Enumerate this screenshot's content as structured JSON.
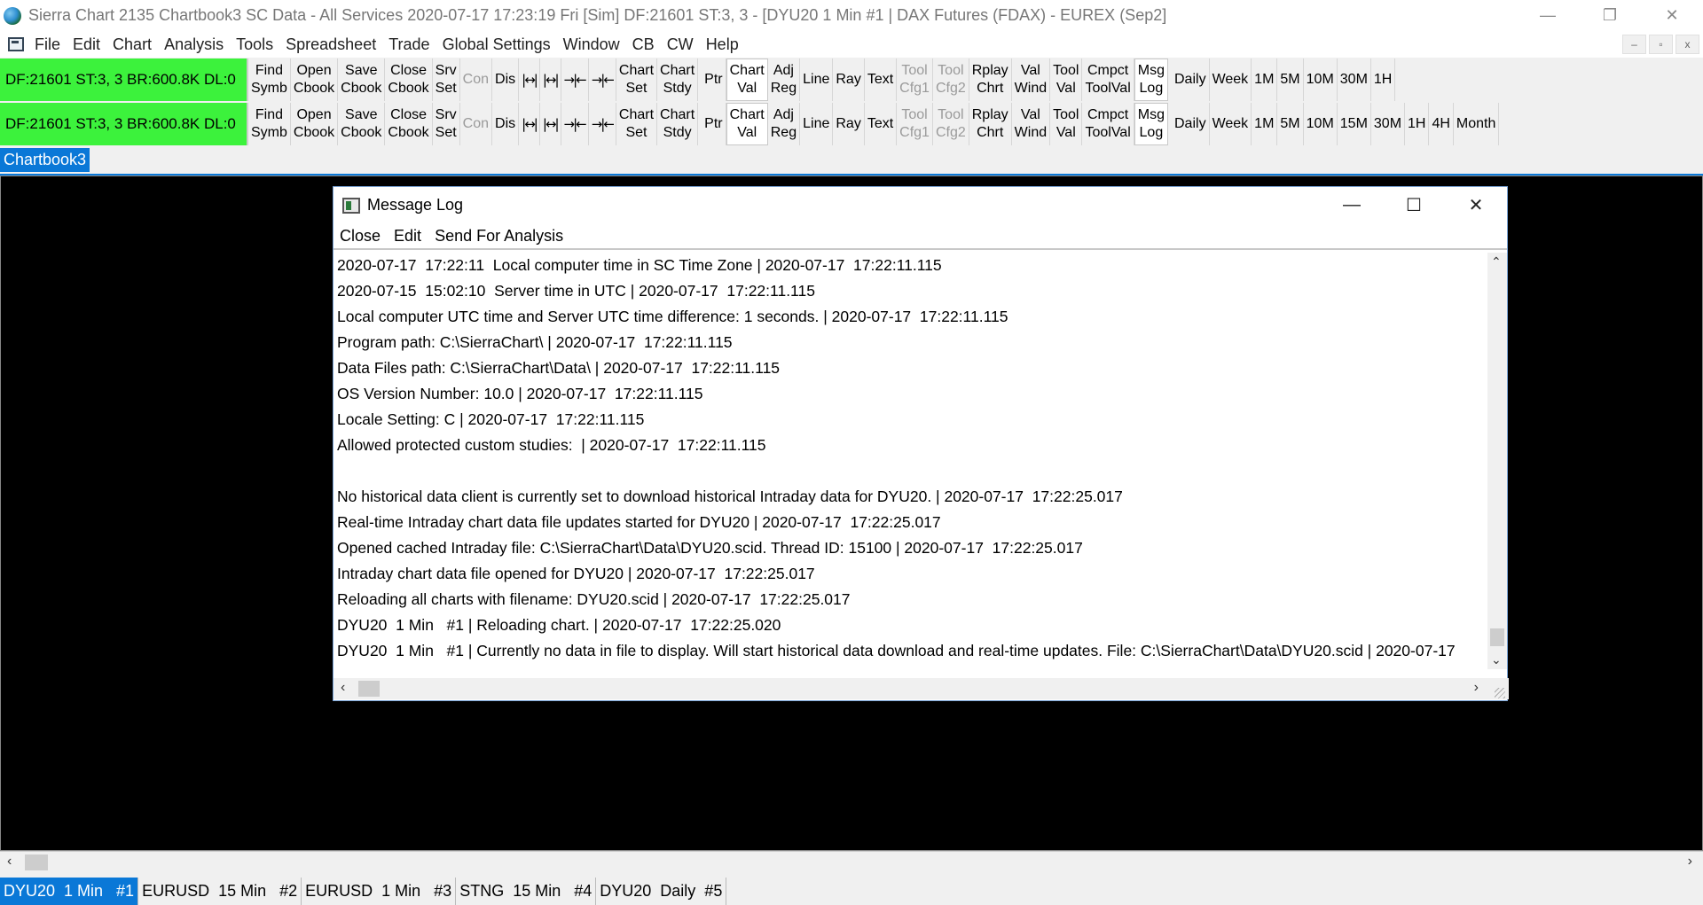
{
  "window": {
    "title": "Sierra Chart 2135 Chartbook3  SC Data - All Services 2020-07-17  17:23:19 Fri [Sim]  DF:21601  ST:3, 3 - [DYU20  1 Min   #1 | DAX Futures (FDAX) - EUREX (Sep2]",
    "controls": [
      "—",
      "❐",
      "✕"
    ]
  },
  "menubar": {
    "items": [
      "File",
      "Edit",
      "Chart",
      "Analysis",
      "Tools",
      "Spreadsheet",
      "Trade",
      "Global Settings",
      "Window",
      "CB",
      "CW",
      "Help"
    ],
    "mdi_controls": [
      "–",
      "▫",
      "x"
    ]
  },
  "toolbar": {
    "status": "DF:21601  ST:3, 3  BR:600.8K  DL:0",
    "find_symb": [
      "Find",
      "Symb"
    ],
    "open_cbook": [
      "Open",
      "Cbook"
    ],
    "save_cbook": [
      "Save",
      "Cbook"
    ],
    "close_cbook": [
      "Close",
      "Cbook"
    ],
    "srv_set": [
      "Srv",
      "Set"
    ],
    "con": "Con",
    "dis": "Dis",
    "glyphs": [
      "|↔|",
      "|↔|",
      "→|←",
      "→|←"
    ],
    "chart_set": [
      "Chart",
      "Set"
    ],
    "chart_stdy": [
      "Chart",
      "Stdy"
    ],
    "ptr": "Ptr",
    "chart_val": [
      "Chart",
      "Val"
    ],
    "adj_reg": [
      "Adj",
      "Reg"
    ],
    "line": "Line",
    "ray": "Ray",
    "text": "Text",
    "tool_cfg1": [
      "Tool",
      "Cfg1"
    ],
    "tool_cfg2": [
      "Tool",
      "Cfg2"
    ],
    "rplay_chrt": [
      "Rplay",
      "Chrt"
    ],
    "val_wind": [
      "Val",
      "Wind"
    ],
    "tool_val": [
      "Tool",
      "Val"
    ],
    "cmpct_toolval": [
      "Cmpct",
      "ToolVal"
    ],
    "msg_log": [
      "Msg",
      "Log"
    ],
    "periods_row1": [
      "Daily",
      "Week",
      "1M",
      "5M",
      "10M",
      "30M",
      "1H"
    ],
    "periods_row2": [
      "Daily",
      "Week",
      "1M",
      "5M",
      "10M",
      "15M",
      "30M",
      "1H",
      "4H",
      "Month"
    ]
  },
  "chartbook_tab": "Chartbook3",
  "message_log": {
    "title": "Message Log",
    "menu": [
      "Close",
      "Edit",
      "Send For Analysis"
    ],
    "controls": [
      "—",
      "☐",
      "✕"
    ],
    "lines": [
      "2020-07-17  17:22:11  Local computer time in SC Time Zone | 2020-07-17  17:22:11.115",
      "2020-07-15  15:02:10  Server time in UTC | 2020-07-17  17:22:11.115",
      "Local computer UTC time and Server UTC time difference: 1 seconds. | 2020-07-17  17:22:11.115",
      "Program path: C:\\SierraChart\\ | 2020-07-17  17:22:11.115",
      "Data Files path: C:\\SierraChart\\Data\\ | 2020-07-17  17:22:11.115",
      "OS Version Number: 10.0 | 2020-07-17  17:22:11.115",
      "Locale Setting: C | 2020-07-17  17:22:11.115",
      "Allowed protected custom studies:  | 2020-07-17  17:22:11.115",
      "",
      "No historical data client is currently set to download historical Intraday data for DYU20. | 2020-07-17  17:22:25.017",
      "Real-time Intraday chart data file updates started for DYU20 | 2020-07-17  17:22:25.017",
      "Opened cached Intraday file: C:\\SierraChart\\Data\\DYU20.scid. Thread ID: 15100 | 2020-07-17  17:22:25.017",
      "Intraday chart data file opened for DYU20 | 2020-07-17  17:22:25.017",
      "Reloading all charts with filename: DYU20.scid | 2020-07-17  17:22:25.017",
      "DYU20  1 Min   #1 | Reloading chart. | 2020-07-17  17:22:25.020",
      "DYU20  1 Min   #1 | Currently no data in file to display. Will start historical data download and real-time updates. File: C:\\SierraChart\\Data\\DYU20.scid | 2020-07-17"
    ]
  },
  "chart_tabs": [
    "DYU20  1 Min   #1",
    "EURUSD  15 Min   #2",
    "EURUSD  1 Min   #3",
    "STNG  15 Min   #4",
    "DYU20  Daily  #5"
  ],
  "colors": {
    "status_green": "#3cf23c",
    "accent_blue": "#0a78d7",
    "workspace_black": "#000000"
  }
}
